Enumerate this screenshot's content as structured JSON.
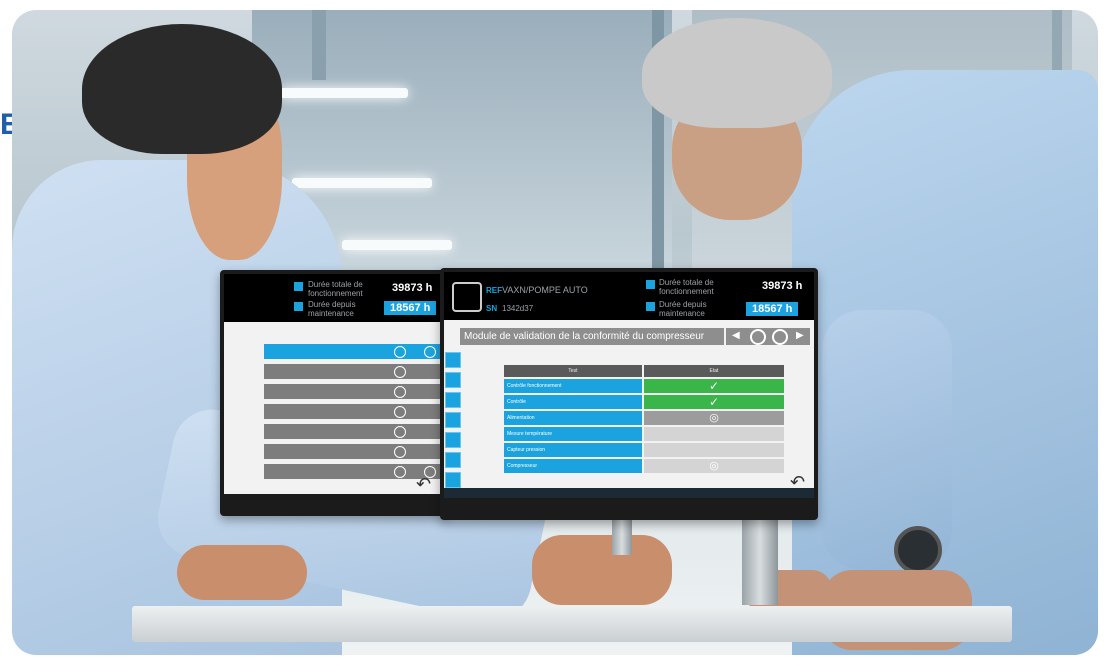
{
  "edge_letter": "E",
  "left_screen": {
    "label_total": "Durée totale de fonctionnement",
    "hours_total": "39873 h",
    "label_since": "Durée depuis maintenance",
    "hours_since": "18567 h"
  },
  "right_screen": {
    "ref_label": "REF",
    "ref_value": "VAXN/POMPE AUTO",
    "sn_label": "SN",
    "sn_value": "1342d37",
    "label_total": "Durée totale de fonctionnement",
    "hours_total": "39873 h",
    "label_since": "Durée depuis maintenance",
    "hours_since": "18567 h",
    "module_title": "Module de validation de la conformité du compresseur",
    "table_header_left": "Test",
    "table_header_right": "Etat",
    "rows": [
      {
        "label": "Contrôle fonctionnement",
        "state": "✓"
      },
      {
        "label": "Contrôle",
        "state": "✓"
      },
      {
        "label": "Alimentation",
        "state": "◎"
      },
      {
        "label": "Mesure température",
        "state": ""
      },
      {
        "label": "Capteur pression",
        "state": ""
      },
      {
        "label": "Compresseur",
        "state": "◎"
      }
    ],
    "back_glyph": "↶"
  },
  "left_back_glyph": "↶"
}
